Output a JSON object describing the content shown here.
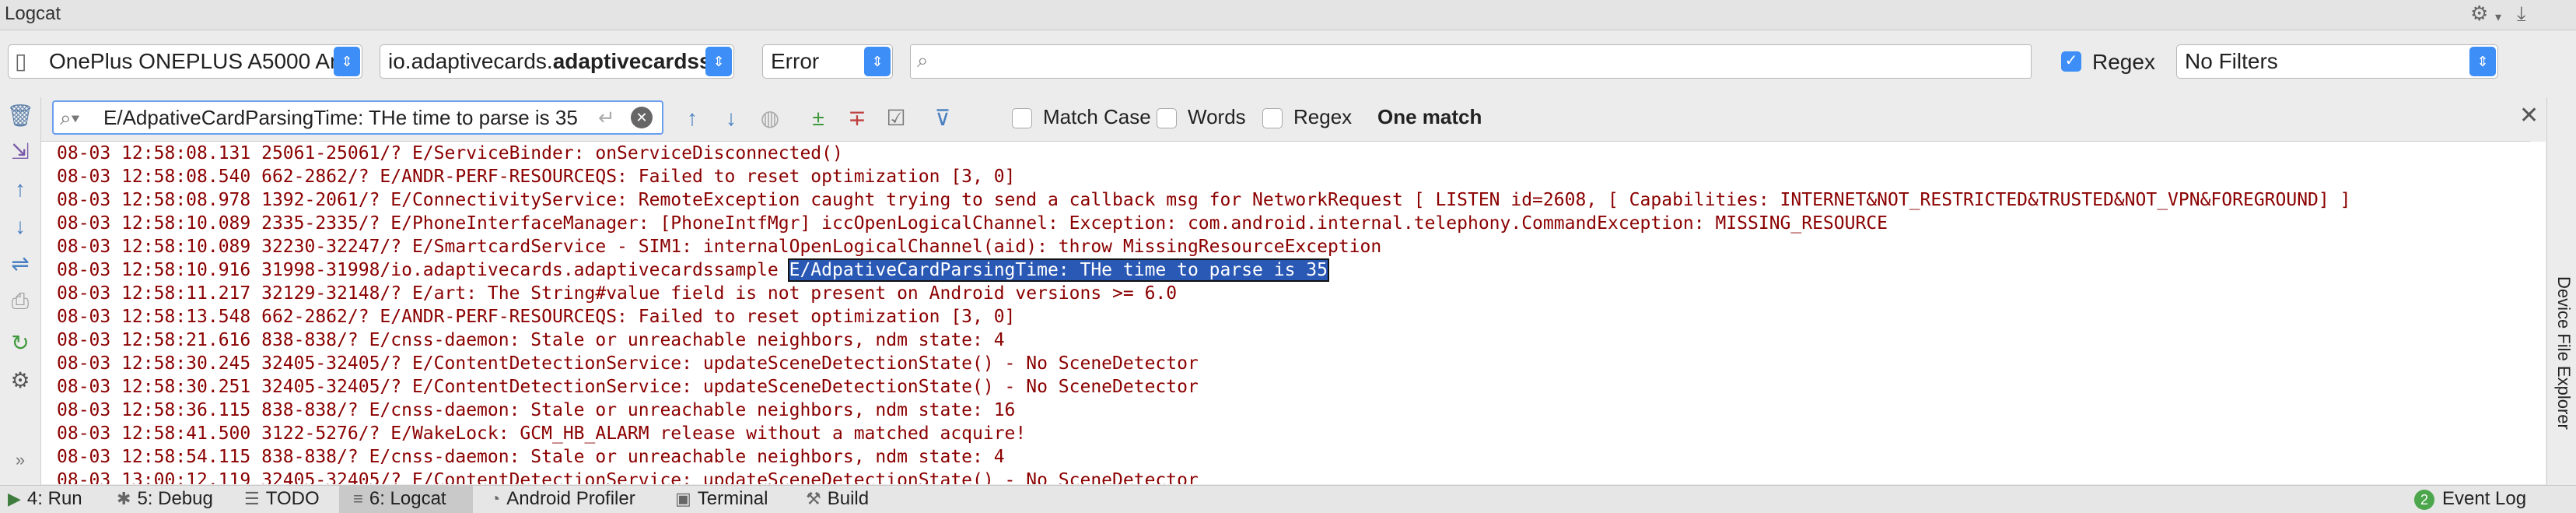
{
  "window": {
    "title": "Logcat"
  },
  "device_row": {
    "device": "OnePlus ONEPLUS A5000 An",
    "process_prefix": "io.adaptivecards.",
    "process_bold": "adaptivecardss",
    "level": "Error",
    "search_placeholder": "",
    "regex_label": "Regex",
    "regex_checked": true,
    "filter": "No Filters"
  },
  "find_bar": {
    "query": "E/AdpativeCardParsingTime: THe time to parse is 35",
    "match_case_label": "Match Case",
    "words_label": "Words",
    "regex_label": "Regex",
    "result": "One match"
  },
  "log": [
    "08-03 12:58:08.131 25061-25061/? E/ServiceBinder: onServiceDisconnected()",
    "08-03 12:58:08.540 662-2862/? E/ANDR-PERF-RESOURCEQS: Failed to reset optimization [3, 0]",
    "08-03 12:58:08.978 1392-2061/? E/ConnectivityService: RemoteException caught trying to send a callback msg for NetworkRequest [ LISTEN id=2608, [ Capabilities: INTERNET&NOT_RESTRICTED&TRUSTED&NOT_VPN&FOREGROUND] ]",
    "08-03 12:58:10.089 2335-2335/? E/PhoneInterfaceManager: [PhoneIntfMgr] iccOpenLogicalChannel: Exception: com.android.internal.telephony.CommandException: MISSING_RESOURCE",
    "08-03 12:58:10.089 32230-32247/? E/SmartcardService - SIM1: internalOpenLogicalChannel(aid): throw MissingResourceException",
    "08-03 12:58:10.916 31998-31998/io.adaptivecards.adaptivecardssample ",
    "08-03 12:58:11.217 32129-32148/? E/art: The String#value field is not present on Android versions >= 6.0",
    "08-03 12:58:13.548 662-2862/? E/ANDR-PERF-RESOURCEQS: Failed to reset optimization [3, 0]",
    "08-03 12:58:21.616 838-838/? E/cnss-daemon: Stale or unreachable neighbors, ndm state: 4",
    "08-03 12:58:30.245 32405-32405/? E/ContentDetectionService: updateSceneDetectionState() - No SceneDetector",
    "08-03 12:58:30.251 32405-32405/? E/ContentDetectionService: updateSceneDetectionState() - No SceneDetector",
    "08-03 12:58:36.115 838-838/? E/cnss-daemon: Stale or unreachable neighbors, ndm state: 16",
    "08-03 12:58:41.500 3122-5276/? E/WakeLock: GCM_HB_ALARM release without a matched acquire!",
    "08-03 12:58:54.115 838-838/? E/cnss-daemon: Stale or unreachable neighbors, ndm state: 4",
    "08-03 13:00:12.119 32405-32405/? E/ContentDetectionService: updateSceneDetectionState() - No SceneDetector"
  ],
  "highlight": "E/AdpativeCardParsingTime: THe time to parse is 35",
  "right_panel": {
    "device_file_explorer": "Device File Explorer"
  },
  "statusbar": {
    "run": "4: Run",
    "debug": "5: Debug",
    "todo": "TODO",
    "logcat": "6: Logcat",
    "profiler": "Android Profiler",
    "terminal": "Terminal",
    "build": "Build",
    "event_count": "2",
    "event_log": "Event Log"
  },
  "colors": {
    "accent": "#3d8ef7",
    "log_text": "#8b0000",
    "selection": "#2a58b5"
  }
}
